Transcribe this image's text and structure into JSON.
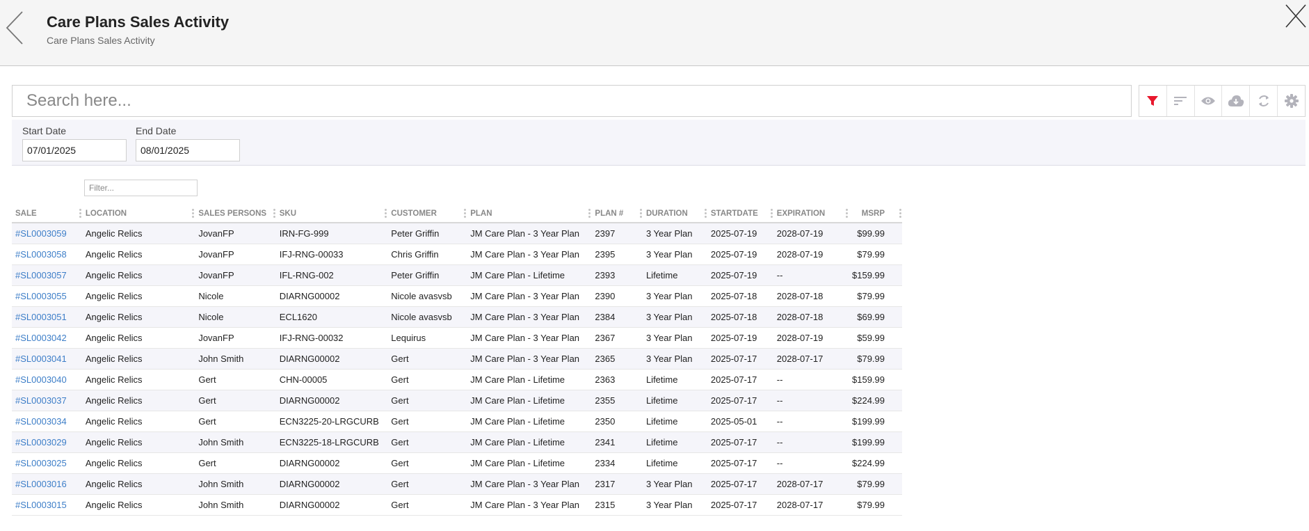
{
  "header": {
    "title": "Care Plans Sales Activity",
    "subtitle": "Care Plans Sales Activity"
  },
  "search": {
    "placeholder": "Search here..."
  },
  "toolbar": {
    "accent": "#e8182d",
    "icons": [
      "filter-icon",
      "sort-icon",
      "eye-icon",
      "cloud-download-icon",
      "refresh-icon",
      "gear-icon"
    ]
  },
  "filters": {
    "start_label": "Start Date",
    "start_value": "07/01/2025",
    "end_label": "End Date",
    "end_value": "08/01/2025",
    "column_filter_placeholder": "Filter..."
  },
  "table": {
    "columns": [
      "SALE",
      "LOCATION",
      "SALES PERSONS",
      "SKU",
      "CUSTOMER",
      "PLAN",
      "PLAN #",
      "DURATION",
      "STARTDATE",
      "EXPIRATION",
      "MSRP"
    ],
    "rows": [
      [
        "#SL0003059",
        "Angelic Relics",
        "JovanFP",
        "IRN-FG-999",
        "Peter Griffin",
        "JM Care Plan - 3 Year Plan",
        "2397",
        "3 Year Plan",
        "2025-07-19",
        "2028-07-19",
        "$99.99"
      ],
      [
        "#SL0003058",
        "Angelic Relics",
        "JovanFP",
        "IFJ-RNG-00033",
        "Chris Griffin",
        "JM Care Plan - 3 Year Plan",
        "2395",
        "3 Year Plan",
        "2025-07-19",
        "2028-07-19",
        "$79.99"
      ],
      [
        "#SL0003057",
        "Angelic Relics",
        "JovanFP",
        "IFL-RNG-002",
        "Peter Griffin",
        "JM Care Plan - Lifetime",
        "2393",
        "Lifetime",
        "2025-07-19",
        "--",
        "$159.99"
      ],
      [
        "#SL0003055",
        "Angelic Relics",
        "Nicole",
        "DIARNG00002",
        "Nicole avasvsb",
        "JM Care Plan - 3 Year Plan",
        "2390",
        "3 Year Plan",
        "2025-07-18",
        "2028-07-18",
        "$79.99"
      ],
      [
        "#SL0003051",
        "Angelic Relics",
        "Nicole",
        "ECL1620",
        "Nicole avasvsb",
        "JM Care Plan - 3 Year Plan",
        "2384",
        "3 Year Plan",
        "2025-07-18",
        "2028-07-18",
        "$69.99"
      ],
      [
        "#SL0003042",
        "Angelic Relics",
        "JovanFP",
        "IFJ-RNG-00032",
        "Lequirus",
        "JM Care Plan - 3 Year Plan",
        "2367",
        "3 Year Plan",
        "2025-07-19",
        "2028-07-19",
        "$59.99"
      ],
      [
        "#SL0003041",
        "Angelic Relics",
        "John Smith",
        "DIARNG00002",
        "Gert",
        "JM Care Plan - 3 Year Plan",
        "2365",
        "3 Year Plan",
        "2025-07-17",
        "2028-07-17",
        "$79.99"
      ],
      [
        "#SL0003040",
        "Angelic Relics",
        "Gert",
        "CHN-00005",
        "Gert",
        "JM Care Plan - Lifetime",
        "2363",
        "Lifetime",
        "2025-07-17",
        "--",
        "$159.99"
      ],
      [
        "#SL0003037",
        "Angelic Relics",
        "Gert",
        "DIARNG00002",
        "Gert",
        "JM Care Plan - Lifetime",
        "2355",
        "Lifetime",
        "2025-07-17",
        "--",
        "$224.99"
      ],
      [
        "#SL0003034",
        "Angelic Relics",
        "Gert",
        "ECN3225-20-LRGCURB",
        "Gert",
        "JM Care Plan - Lifetime",
        "2350",
        "Lifetime",
        "2025-05-01",
        "--",
        "$199.99"
      ],
      [
        "#SL0003029",
        "Angelic Relics",
        "John Smith",
        "ECN3225-18-LRGCURB",
        "Gert",
        "JM Care Plan - Lifetime",
        "2341",
        "Lifetime",
        "2025-07-17",
        "--",
        "$199.99"
      ],
      [
        "#SL0003025",
        "Angelic Relics",
        "Gert",
        "DIARNG00002",
        "Gert",
        "JM Care Plan - Lifetime",
        "2334",
        "Lifetime",
        "2025-07-17",
        "--",
        "$224.99"
      ],
      [
        "#SL0003016",
        "Angelic Relics",
        "John Smith",
        "DIARNG00002",
        "Gert",
        "JM Care Plan - 3 Year Plan",
        "2317",
        "3 Year Plan",
        "2025-07-17",
        "2028-07-17",
        "$79.99"
      ],
      [
        "#SL0003015",
        "Angelic Relics",
        "John Smith",
        "DIARNG00002",
        "Gert",
        "JM Care Plan - 3 Year Plan",
        "2315",
        "3 Year Plan",
        "2025-07-17",
        "2028-07-17",
        "$79.99"
      ]
    ]
  }
}
